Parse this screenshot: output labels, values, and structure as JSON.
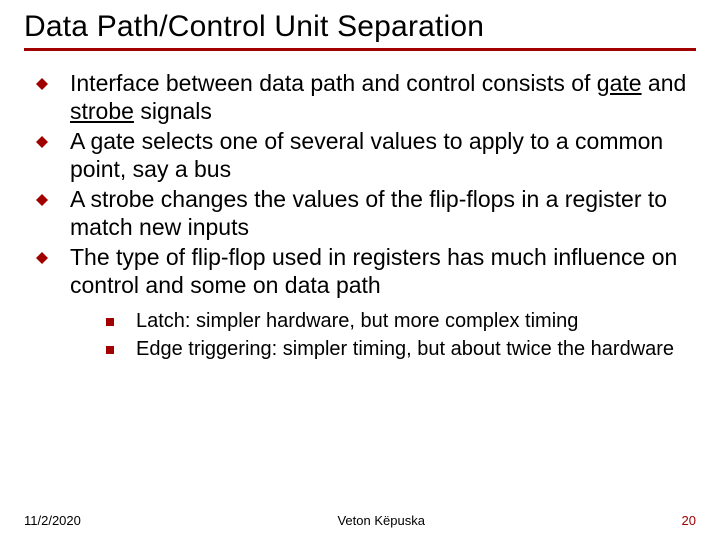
{
  "title": "Data Path/Control Unit Separation",
  "bullets": [
    {
      "pre": "Interface between data path and control consists of ",
      "u1": "gate",
      "mid": " and ",
      "u2": "strobe",
      "post": " signals"
    },
    {
      "text": "A gate selects one of several values to apply to a common point, say a bus"
    },
    {
      "text": "A strobe changes the values of the flip-flops in a register to match new inputs"
    },
    {
      "text": "The type of flip-flop used in registers has much influence on control and some on data path"
    }
  ],
  "sub_bullets": [
    "Latch: simpler hardware, but more complex timing",
    "Edge triggering: simpler timing, but about twice the hardware"
  ],
  "footer": {
    "date": "11/2/2020",
    "author": "Veton Këpuska",
    "page": "20"
  },
  "colors": {
    "accent": "#a00000"
  }
}
